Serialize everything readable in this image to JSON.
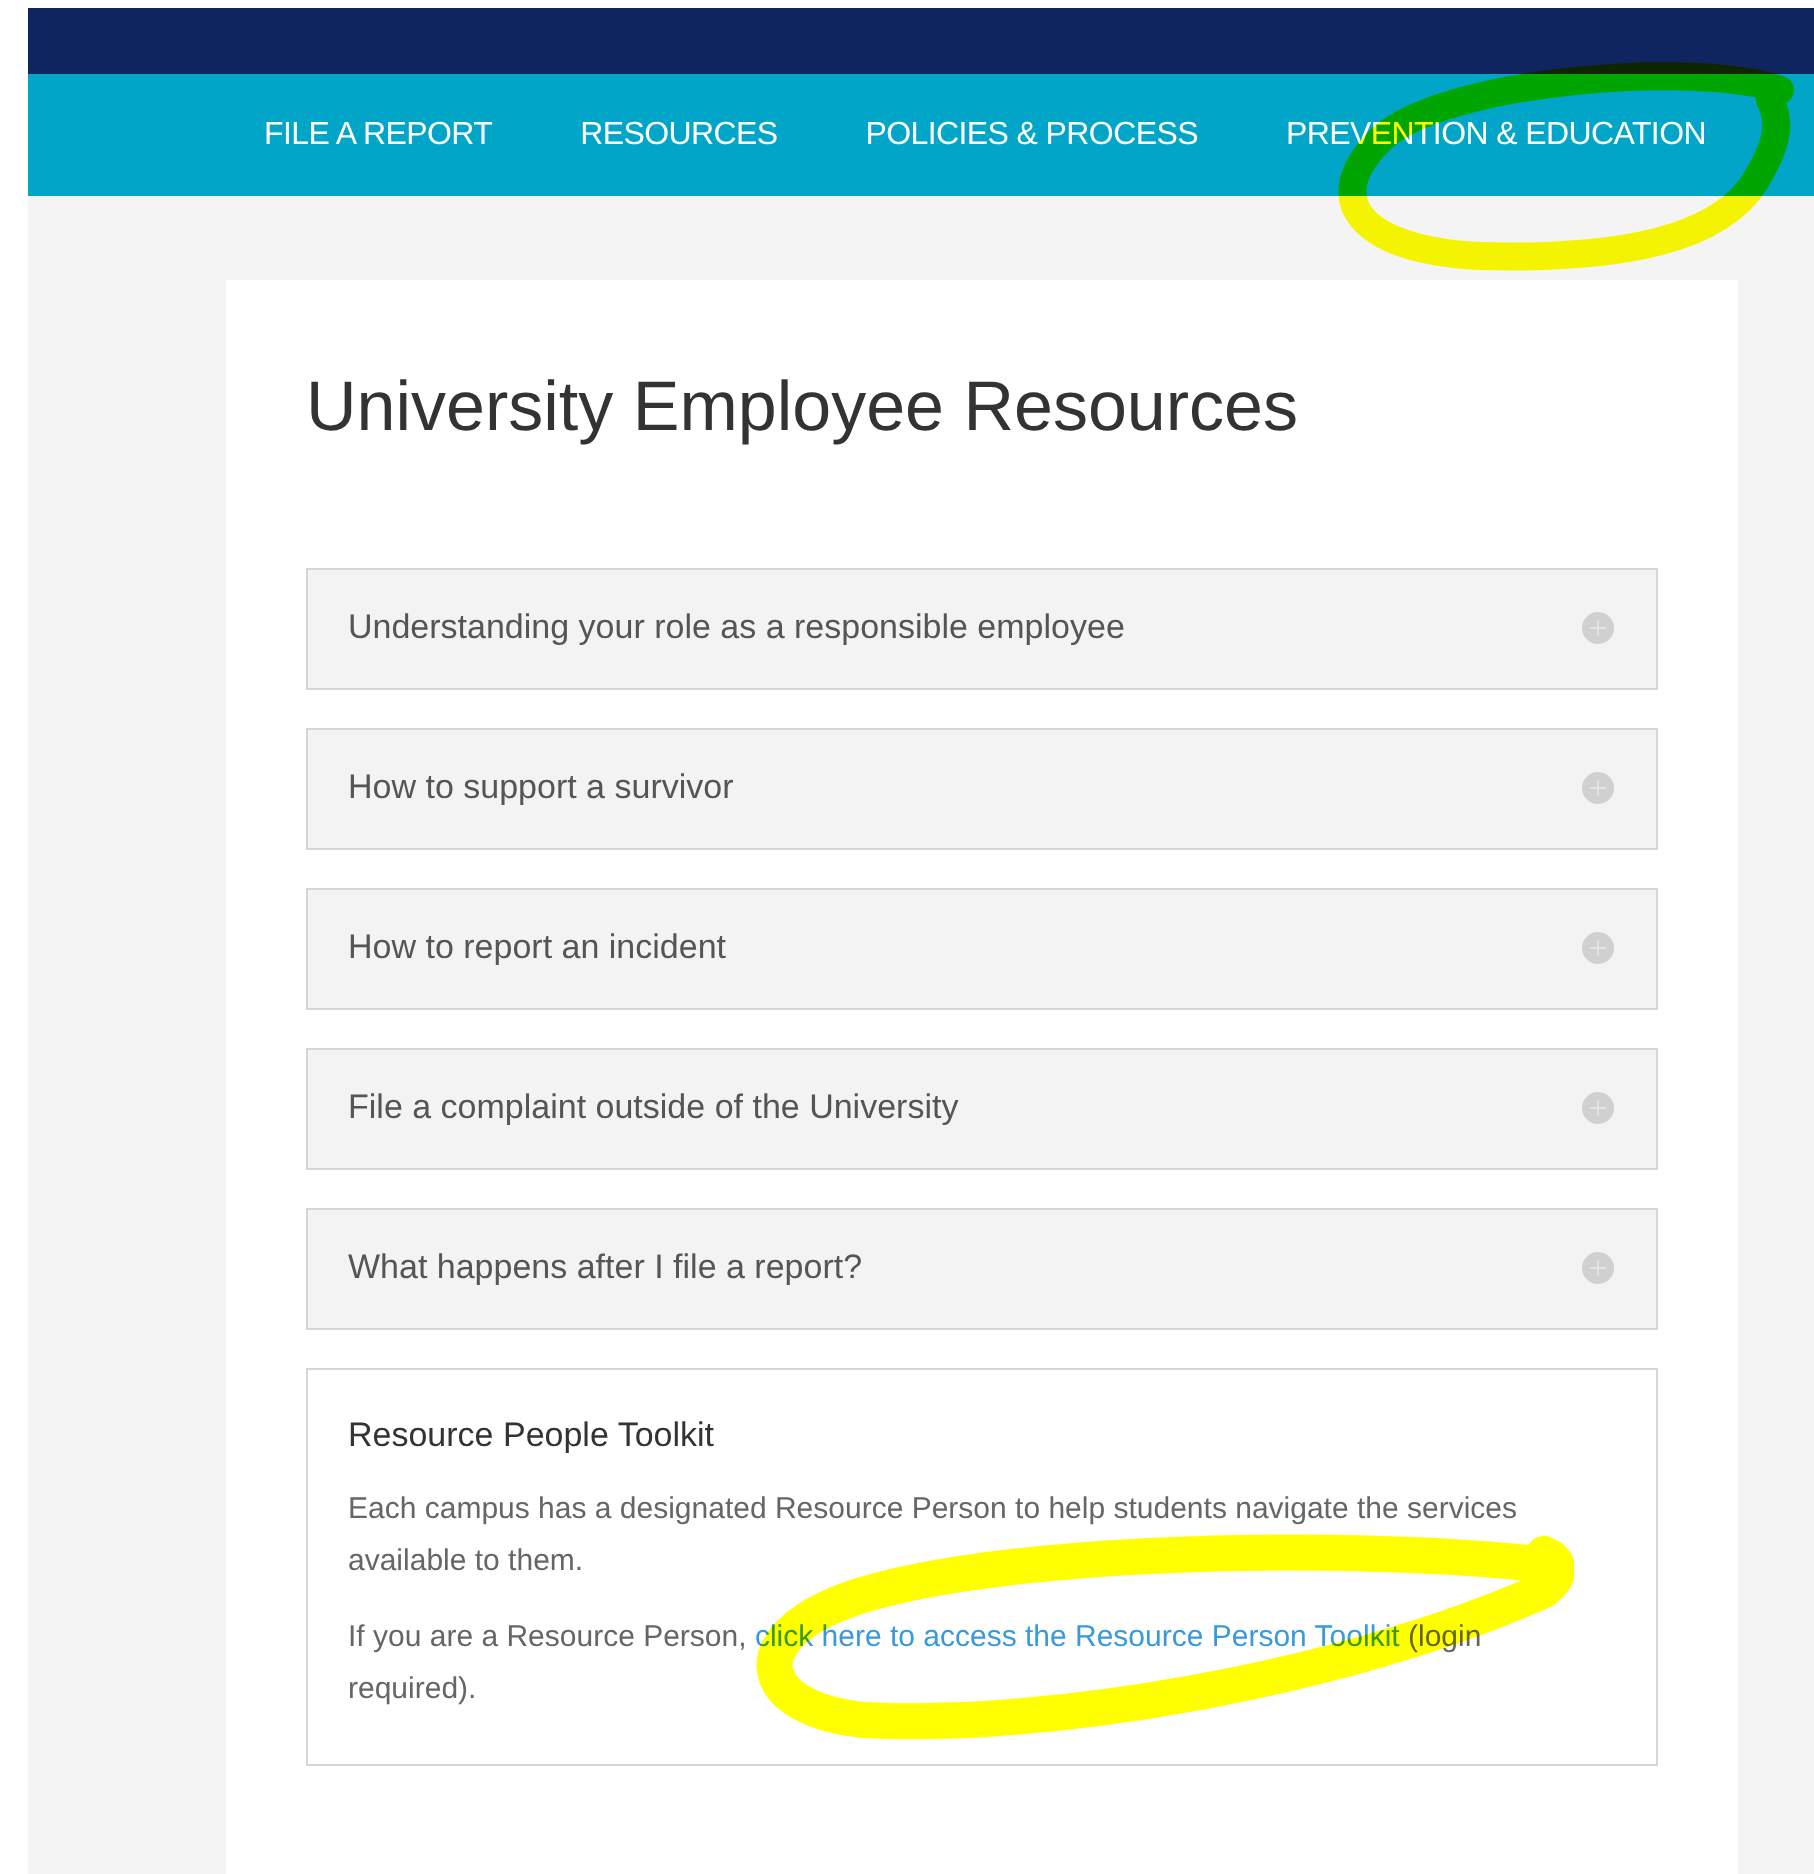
{
  "nav": {
    "items": [
      {
        "label": "FILE A REPORT"
      },
      {
        "label": "RESOURCES"
      },
      {
        "label": "POLICIES & PROCESS"
      },
      {
        "label": "PREVENTION & EDUCATION"
      }
    ]
  },
  "page": {
    "title": "University Employee Resources",
    "accordion": [
      {
        "label": "Understanding your role as a responsible employee",
        "expanded": false
      },
      {
        "label": "How to support a survivor",
        "expanded": false
      },
      {
        "label": "How to report an incident",
        "expanded": false
      },
      {
        "label": "File a complaint outside of the University",
        "expanded": false
      },
      {
        "label": "What happens after I file a report?",
        "expanded": false
      }
    ],
    "toolkit": {
      "title": "Resource People Toolkit",
      "text": "Each campus has a designated Resource Person to help students navigate the services available to them.",
      "link_before": "If you are a Resource Person, ",
      "link": "click here to access the Resource Person Toolkit",
      "link_after": " (login required)."
    }
  }
}
